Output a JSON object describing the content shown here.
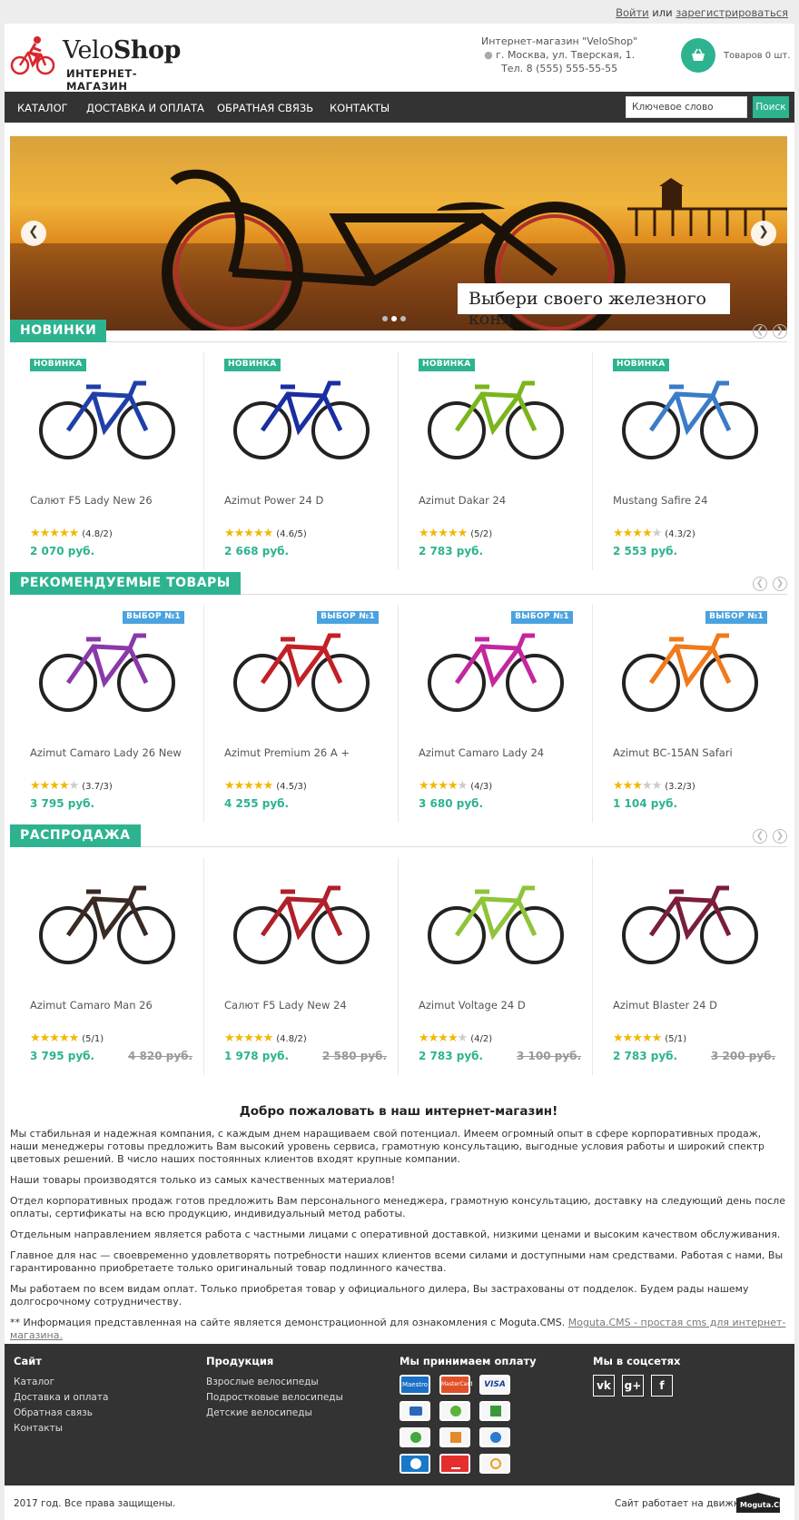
{
  "top": {
    "login": "Войти",
    "or": "или",
    "register": "зарегистрироваться"
  },
  "logo": {
    "name_v": "Velo",
    "name_s": "Shop",
    "subtitle": "ИНТЕРНЕТ-МАГАЗИН"
  },
  "contacts": {
    "line1": "Интернет-магазин \"VeloShop\"",
    "line2": "г. Москва, ул. Тверская, 1.",
    "line3": "Тел. 8 (555) 555-55-55"
  },
  "cart": {
    "text": "Товаров 0 шт."
  },
  "nav": {
    "items": [
      "КАТАЛОГ",
      "ДОСТАВКА И ОПЛАТА",
      "ОБРАТНАЯ СВЯЗЬ",
      "КОНТАКТЫ"
    ],
    "search_placeholder": "Ключевое слово",
    "search_button": "Поиск"
  },
  "banner": {
    "caption": "Выбери своего железного коня"
  },
  "sections": [
    {
      "title": "НОВИНКИ",
      "badge": "НОВИНКА",
      "badge_color": "#2db38f",
      "products": [
        {
          "name": "Салют F5 Lady New 26",
          "rating": 4.8,
          "rating_text": "(4.8/2)",
          "price": "2 070 руб.",
          "old": ""
        },
        {
          "name": "Azimut Power 24 D",
          "rating": 4.6,
          "rating_text": "(4.6/5)",
          "price": "2 668 руб.",
          "old": ""
        },
        {
          "name": "Azimut Dakar 24",
          "rating": 5,
          "rating_text": "(5/2)",
          "price": "2 783 руб.",
          "old": ""
        },
        {
          "name": "Mustang Safire 24",
          "rating": 4.3,
          "rating_text": "(4.3/2)",
          "price": "2 553 руб.",
          "old": ""
        }
      ]
    },
    {
      "title": "РЕКОМЕНДУЕМЫЕ ТОВАРЫ",
      "badge": "ВЫБОР №1",
      "badge_color": "#4aa3df",
      "products": [
        {
          "name": "Azimut Camaro Lady 26 New",
          "rating": 3.7,
          "rating_text": "(3.7/3)",
          "price": "3 795 руб.",
          "old": ""
        },
        {
          "name": "Azimut Premium 26 A +",
          "rating": 4.5,
          "rating_text": "(4.5/3)",
          "price": "4 255 руб.",
          "old": ""
        },
        {
          "name": "Azimut Camaro Lady 24",
          "rating": 4,
          "rating_text": "(4/3)",
          "price": "3 680 руб.",
          "old": ""
        },
        {
          "name": "Azimut BC-15AN Safari",
          "rating": 3.2,
          "rating_text": "(3.2/3)",
          "price": "1 104 руб.",
          "old": ""
        }
      ]
    },
    {
      "title": "РАСПРОДАЖА",
      "badge": "",
      "badge_color": "",
      "products": [
        {
          "name": "Azimut Camaro Man 26",
          "rating": 5,
          "rating_text": "(5/1)",
          "price": "3 795 руб.",
          "old": "4 820 руб."
        },
        {
          "name": "Салют F5 Lady New 24",
          "rating": 4.8,
          "rating_text": "(4.8/2)",
          "price": "1 978 руб.",
          "old": "2 580 руб."
        },
        {
          "name": "Azimut Voltage 24 D",
          "rating": 4,
          "rating_text": "(4/2)",
          "price": "2 783 руб.",
          "old": "3 100 руб."
        },
        {
          "name": "Azimut Blaster 24 D",
          "rating": 5,
          "rating_text": "(5/1)",
          "price": "2 783 руб.",
          "old": "3 200 руб."
        }
      ]
    }
  ],
  "welcome": {
    "title": "Добро пожаловать в наш интернет-магазин!",
    "p1": "Мы стабильная и надежная компания, с каждым днем наращиваем свой потенциал. Имеем огромный опыт в сфере корпоративных продаж, наши менеджеры готовы предложить Вам высокий уровень сервиса, грамотную консультацию, выгодные условия работы и широкий спектр цветовых решений. В число наших постоянных клиентов входят крупные компании.",
    "p2": "Наши товары производятся только из самых качественных материалов!",
    "p3": "Отдел корпоративных продаж готов предложить Вам персонального менеджера, грамотную консультацию, доставку на следующий день после оплаты, сертификаты на всю продукцию, индивидуальный метод работы.",
    "p4": "Отдельным направлением является работа с частными лицами с оперативной доставкой, низкими ценами и высоким качеством обслуживания.",
    "p5": "Главное для нас — своевременно удовлетворять потребности наших клиентов всеми силами и доступными нам средствами. Работая с нами, Вы гарантированно приобретаете только оригинальный товар подлинного качества.",
    "p6": "Мы работаем по всем видам оплат. Только приобретая товар у официального дилера, Вы застрахованы от подделок. Будем рады нашему долгосрочному сотрудничеству.",
    "p7": "** Информация представленная на сайте является демонстрационной для ознакомления с Moguta.CMS.",
    "p7_link": "Moguta.CMS - простая cms для интернет-магазина."
  },
  "footer": {
    "site_title": "Сайт",
    "site_links": [
      "Каталог",
      "Доставка и оплата",
      "Обратная связь",
      "Контакты"
    ],
    "prod_title": "Продукция",
    "prod_links": [
      "Взрослые велосипеды",
      "Подростковые велосипеды",
      "Детские велосипеды"
    ],
    "pay_title": "Мы принимаем оплату",
    "pay_labels": [
      "Maestro",
      "MasterCard",
      "VISA"
    ],
    "soc_title": "Мы в соцсетях",
    "soc_labels": [
      "vk",
      "g+",
      "f"
    ],
    "copyright": "2017 год. Все права защищены.",
    "engine": "Сайт работает на движке:",
    "engine_logo": "Moguta.CMS"
  }
}
